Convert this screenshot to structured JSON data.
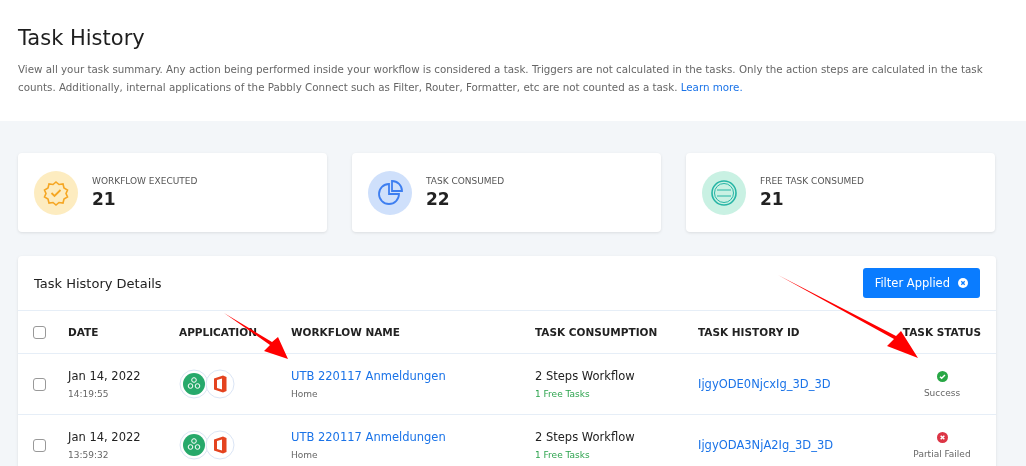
{
  "header": {
    "title": "Task History",
    "description": "View all your task summary. Any action being performed inside your workflow is considered a task. Triggers are not calculated in the tasks. Only the action steps are calculated in the task counts. Additionally, internal applications of the Pabbly Connect such as Filter, Router, Formatter, etc are not counted as a task.",
    "link": "Learn more."
  },
  "stats": [
    {
      "kind": "workflow",
      "label": "WORKFLOW EXECUTED",
      "value": "21"
    },
    {
      "kind": "task",
      "label": "TASK CONSUMED",
      "value": "22"
    },
    {
      "kind": "free",
      "label": "FREE TASK CONSUMED",
      "value": "21"
    }
  ],
  "details": {
    "title": "Task History Details",
    "filter_button": "Filter Applied",
    "columns": [
      "DATE",
      "APPLICATION",
      "WORKFLOW NAME",
      "TASK CONSUMPTION",
      "TASK HISTORY ID",
      "TASK STATUS"
    ],
    "header_checked": false,
    "rows": [
      {
        "checked": false,
        "date": "Jan 14, 2022",
        "time": "14:19:55",
        "workflow": "UTB 220117 Anmeldungen",
        "folder": "Home",
        "consumption": "2 Steps Workflow",
        "free_tasks": "1 Free Tasks",
        "history_id": "IjgyODE0NjcxIg_3D_3D",
        "kind": "success",
        "status_label": "Success"
      },
      {
        "checked": false,
        "date": "Jan 14, 2022",
        "time": "13:59:32",
        "workflow": "UTB 220117 Anmeldungen",
        "folder": "Home",
        "consumption": "2 Steps Workflow",
        "free_tasks": "1 Free Tasks",
        "history_id": "IjgyODA3NjA2Ig_3D_3D",
        "kind": "failed",
        "status_label": "Partial Failed"
      }
    ]
  }
}
